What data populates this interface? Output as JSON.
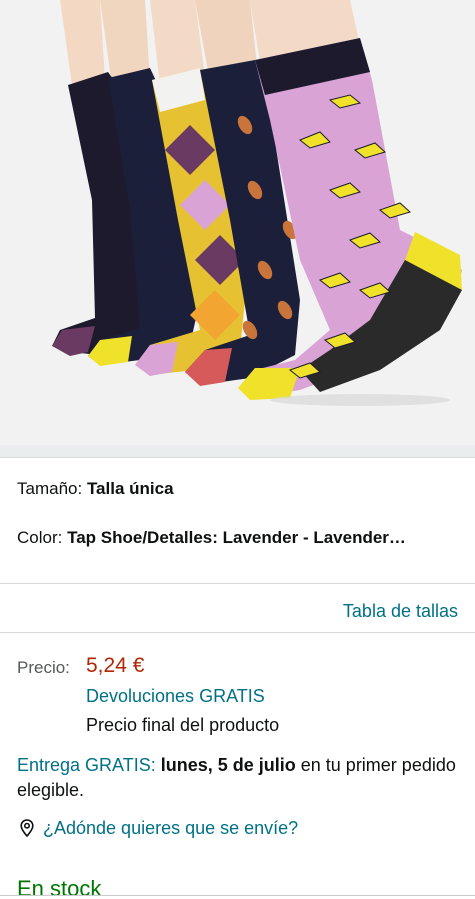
{
  "product": {
    "image_alt": "Calcetines - pack de 5 pares",
    "colors": {
      "background": "#f2f2f2",
      "sock_dark": "#1e1a2e",
      "sock_navy": "#1c1f3a",
      "sock_pink": "#d9a3d6",
      "sock_yellow": "#f0e12a",
      "sock_purple": "#6a3a62",
      "sock_coral": "#d65a5a",
      "sock_orange": "#f2a530"
    }
  },
  "variations": {
    "size_label": "Tamaño: ",
    "size_value": "Talla única",
    "color_label": "Color: ",
    "color_value": "Tap Shoe/Detalles: Lavender - Lavender…"
  },
  "size_chart": {
    "label": "Tabla de tallas"
  },
  "pricing": {
    "price_label": "Precio:",
    "price_value": "5,24 €",
    "returns": "Devoluciones GRATIS",
    "final_price_note": "Precio final del producto"
  },
  "delivery": {
    "free_label": "Entrega GRATIS:",
    "date": "lunes, 5 de julio",
    "suffix": " en tu primer pedido elegible."
  },
  "location": {
    "icon": "location-pin-icon",
    "label": "¿Adónde quieres que se envíe?"
  },
  "availability": {
    "label": "En stock"
  },
  "theme": {
    "link": "#007185",
    "price": "#b12704",
    "stock": "#007600"
  }
}
